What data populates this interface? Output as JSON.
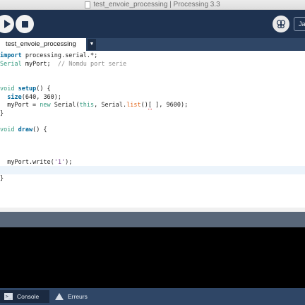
{
  "window": {
    "title": "test_envoie_processing | Processing 3.3"
  },
  "toolbar": {
    "mode_label": "Ja"
  },
  "tabs": [
    {
      "label": "test_envoie_processing"
    }
  ],
  "tab_menu_glyph": "▼",
  "code": {
    "l1_import": "import",
    "l1_rest": " processing.serial.*;",
    "l2_class": "Serial",
    "l2_var": " myPort;  ",
    "l2_comment": "// Nomdu port serie",
    "l5_void": "void",
    "l5_name": "setup",
    "l5_rest": "() {",
    "l6_indent": "  ",
    "l6_fn": "size",
    "l6_args": "(640, 360);",
    "l7_a": "  myPort = ",
    "l7_new": "new",
    "l7_b": " Serial(",
    "l7_this": "this",
    "l7_c": ", Serial.",
    "l7_list": "list",
    "l7_d": "()",
    "l7_err": "[",
    "l7_e": " ], 9600);",
    "l8": "}",
    "l10_void": "void",
    "l10_name": "draw",
    "l10_rest": "() {",
    "l14_a": "  myPort.write(",
    "l14_str": "'1'",
    "l14_b": ");",
    "l16": "}"
  },
  "bottom_tabs": [
    {
      "label": "Console",
      "icon": "console-icon"
    },
    {
      "label": "Erreurs",
      "icon": "warning-icon"
    }
  ],
  "colors": {
    "toolbar": "#1e3250",
    "tabbar": "#2f4666",
    "keyword_green": "#33997e",
    "keyword_blue": "#006699",
    "function_orange": "#e2661a",
    "comment_gray": "#8c8c8c"
  }
}
